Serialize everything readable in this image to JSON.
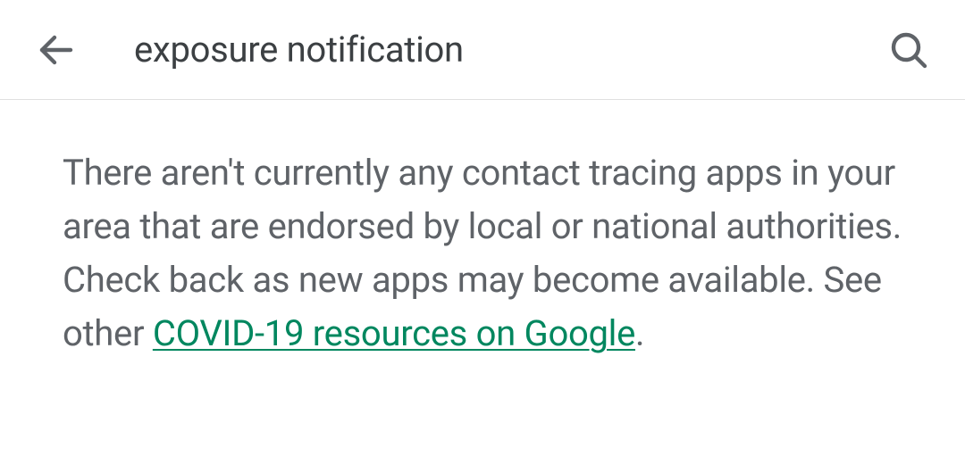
{
  "header": {
    "search_query": "exposure notification"
  },
  "content": {
    "message_before_link": "There aren't currently any contact tracing apps in your area that are endorsed by local or national authorities. Check back as new apps may become available. See other ",
    "link_text": "COVID-19 resources on Google",
    "message_after_link": "."
  }
}
